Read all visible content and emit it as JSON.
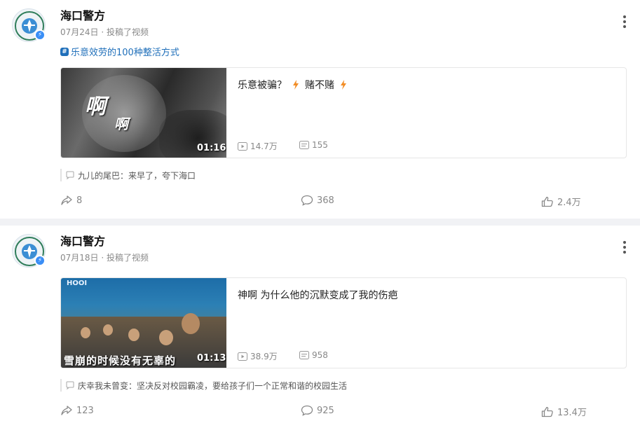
{
  "colors": {
    "topic": "#1f6fba",
    "fire": "#f28d25",
    "verify_badge": "#3a8ef6"
  },
  "posts": [
    {
      "author": "海口警方",
      "date": "07月24日",
      "meta_sep": "·",
      "action": "投稿了视频",
      "topic": "乐意效劳的100种整活方式",
      "video": {
        "thumb_big": "啊",
        "thumb_small": "啊",
        "duration": "01:16",
        "title_part1": "乐意被骗？",
        "title_part2": "赌不赌",
        "views": "14.7万",
        "danmaku": "155"
      },
      "comment": {
        "user": "九儿的尾巴：",
        "text": "来早了，夸下海口"
      },
      "shares": "8",
      "comments": "368",
      "likes": "2.4万"
    },
    {
      "author": "海口警方",
      "date": "07月18日",
      "meta_sep": "·",
      "action": "投稿了视频",
      "video": {
        "thumb_sign": "HOOI",
        "thumb_subtitle": "雪崩的时候没有无辜的",
        "duration": "01:13",
        "title": "神啊 为什么他的沉默变成了我的伤疤",
        "views": "38.9万",
        "danmaku": "958"
      },
      "comment": {
        "user": "庆幸我未曾变：",
        "text": "坚决反对校园霸凌，要给孩子们一个正常和谐的校园生活"
      },
      "shares": "123",
      "comments": "925",
      "likes": "13.4万"
    }
  ]
}
